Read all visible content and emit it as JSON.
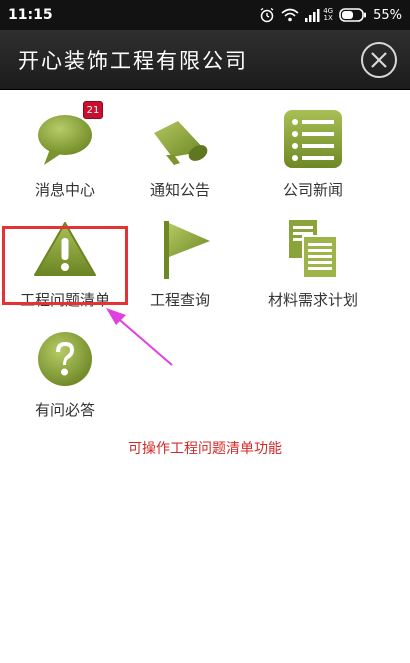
{
  "status_bar": {
    "time": "11:15",
    "network_top": "4G",
    "network_bottom": "1X",
    "battery": "55%",
    "icons": [
      "alarm-icon",
      "wifi-icon",
      "signal-icon",
      "battery-icon"
    ]
  },
  "header": {
    "title": "开心装饰工程有限公司",
    "close_icon": "close-circle-icon"
  },
  "menu": [
    {
      "label": "消息中心",
      "icon": "message-bubble-icon",
      "badge": "21"
    },
    {
      "label": "通知公告",
      "icon": "megaphone-icon"
    },
    {
      "label": "公司新闻",
      "icon": "news-list-icon"
    },
    {
      "label": "工程问题清单",
      "icon": "warning-icon"
    },
    {
      "label": "工程查询",
      "icon": "flag-icon"
    },
    {
      "label": "材料需求计划",
      "icon": "documents-icon"
    },
    {
      "label": "有问必答",
      "icon": "question-icon"
    }
  ],
  "annotation": {
    "text": "可操作工程问题清单功能",
    "color": "#d42828"
  },
  "colors": {
    "icon_green": "#8aa33a",
    "header_bg": "#222222",
    "highlight_border": "#e53232",
    "arrow": "#e040e0"
  }
}
